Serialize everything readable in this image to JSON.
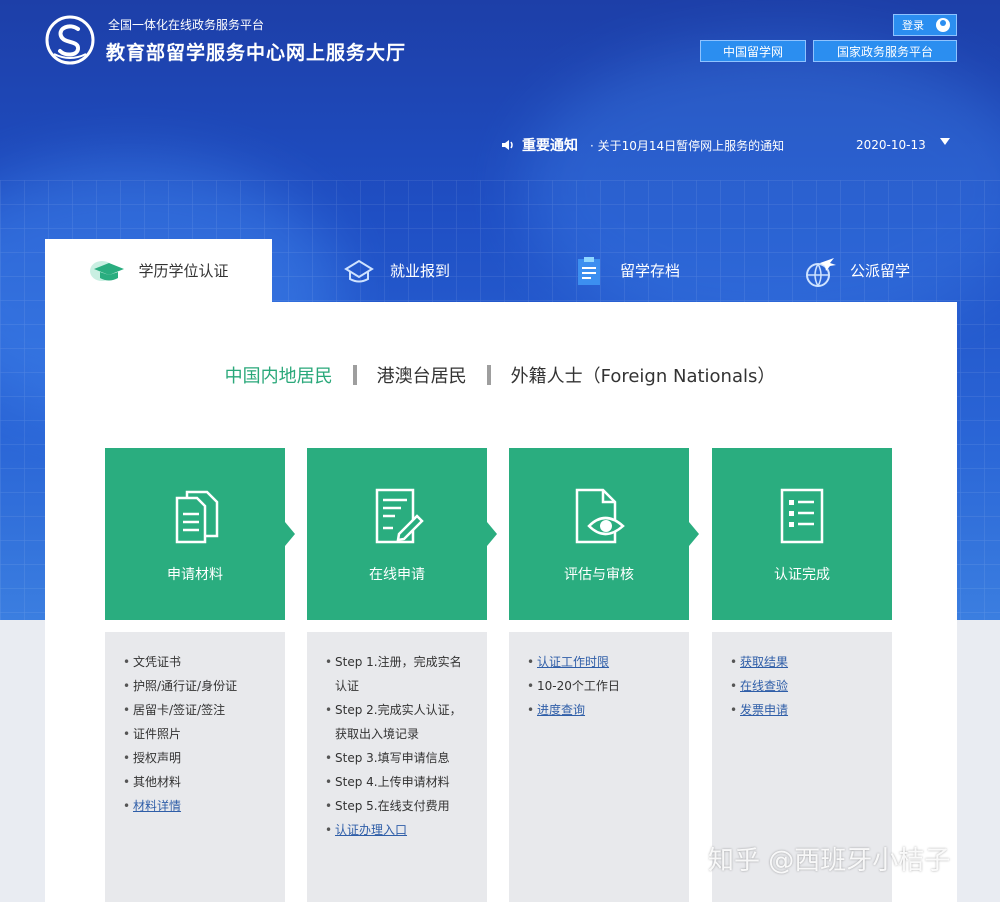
{
  "header": {
    "subtitle": "全国一体化在线政务服务平台",
    "title": "教育部留学服务中心网上服务大厅",
    "login_label": "登录",
    "links": [
      "中国留学网",
      "国家政务服务平台"
    ]
  },
  "notice": {
    "label": "重要通知",
    "text": "· 关于10月14日暂停网上服务的通知",
    "date": "2020-10-13"
  },
  "tabs": [
    {
      "label": "学历学位认证",
      "icon": "graduation-cap-icon",
      "active": true
    },
    {
      "label": "就业报到",
      "icon": "briefcase-icon",
      "active": false
    },
    {
      "label": "留学存档",
      "icon": "archive-icon",
      "active": false
    },
    {
      "label": "公派留学",
      "icon": "airplane-globe-icon",
      "active": false
    }
  ],
  "residency": {
    "options": [
      "中国内地居民",
      "港澳台居民",
      "外籍人士（Foreign Nationals）"
    ],
    "selected": 0
  },
  "steps": [
    {
      "label": "申请材料",
      "icon": "documents-icon"
    },
    {
      "label": "在线申请",
      "icon": "form-edit-icon"
    },
    {
      "label": "评估与审核",
      "icon": "document-eye-icon"
    },
    {
      "label": "认证完成",
      "icon": "checklist-icon"
    }
  ],
  "details": [
    {
      "items": [
        {
          "text": "文凭证书",
          "link": false
        },
        {
          "text": "护照/通行证/身份证",
          "link": false
        },
        {
          "text": "居留卡/签证/签注",
          "link": false
        },
        {
          "text": "证件照片",
          "link": false
        },
        {
          "text": "授权声明",
          "link": false
        },
        {
          "text": "其他材料",
          "link": false
        },
        {
          "text": "材料详情",
          "link": true
        }
      ]
    },
    {
      "items": [
        {
          "text": "Step 1.注册，完成实名",
          "link": false
        },
        {
          "text": "认证",
          "link": false,
          "cont": true
        },
        {
          "text": "Step 2.完成实人认证，",
          "link": false
        },
        {
          "text": "获取出入境记录",
          "link": false,
          "cont": true
        },
        {
          "text": "Step 3.填写申请信息",
          "link": false
        },
        {
          "text": "Step 4.上传申请材料",
          "link": false
        },
        {
          "text": "Step 5.在线支付费用",
          "link": false
        },
        {
          "text": "认证办理入口",
          "link": true
        }
      ]
    },
    {
      "items": [
        {
          "text": "认证工作时限",
          "link": true
        },
        {
          "text": "10-20个工作日",
          "link": false
        },
        {
          "text": "进度查询",
          "link": true
        }
      ]
    },
    {
      "items": [
        {
          "text": "获取结果",
          "link": true
        },
        {
          "text": "在线查验",
          "link": true
        },
        {
          "text": "发票申请",
          "link": true
        }
      ]
    }
  ],
  "watermark": "知乎 @西班牙小桔子",
  "colors": {
    "primary_blue": "#1f4fc4",
    "accent_green": "#2aad7f",
    "link_blue": "#2f5ea8"
  }
}
